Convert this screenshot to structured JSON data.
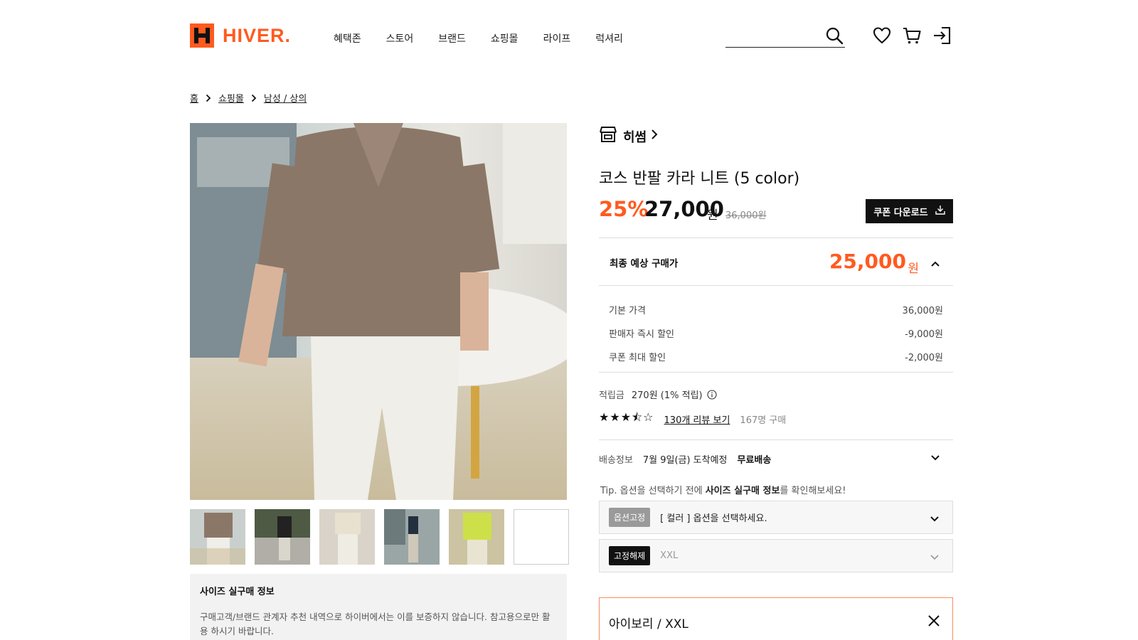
{
  "header": {
    "logo_letter": "H",
    "logo_text": "HIVER.",
    "nav": [
      "혜택존",
      "스토어",
      "브랜드",
      "쇼핑몰",
      "라이프",
      "럭셔리"
    ],
    "search_value": "",
    "icons": [
      "search-icon",
      "heart-icon",
      "cart-icon",
      "login-icon"
    ]
  },
  "breadcrumb": [
    "홈",
    "쇼핑몰",
    "남성 / 상의"
  ],
  "gallery": {
    "thumbnail_count": 6
  },
  "size_info": {
    "title": "사이즈 실구매 정보",
    "desc": "구매고객/브랜드 관계자 추천 내역으로 하이버에서는 이를 보증하지 않습니다. 참고용으로만 활용 하시기 바랍니다."
  },
  "product": {
    "brand": "히썸",
    "title": "코스 반팔 카라 니트 (5 color)",
    "discount": "25%",
    "sale_price": "27,000",
    "won": "원",
    "original_price": "36,000원",
    "coupon_label": "쿠폰 다운로드",
    "final_label": "최종 예상 구매가",
    "final_price": "25,000",
    "breakdown": [
      {
        "label": "기본 가격",
        "value": "36,000원"
      },
      {
        "label": "판매자 즉시 할인",
        "value": "-9,000원"
      },
      {
        "label": "쿠폰 최대 할인",
        "value": "-2,000원"
      }
    ],
    "points_label": "적립금",
    "points_value": "270원 (1% 적립)",
    "stars": "★★★⯪☆",
    "rating": 3.5,
    "review_link": "130개 리뷰 보기",
    "purchase_count": "167명 구매",
    "shipping_label": "배송정보",
    "shipping_date": "7월 9일(금) 도착예정",
    "shipping_fee": "무료배송",
    "tip_prefix": "Tip. 옵션을 선택하기 전에 ",
    "tip_bold": "사이즈 실구매 정보",
    "tip_suffix": "를 확인해보세요!",
    "option1_badge": "옵션고정",
    "option1_text": "[ 컬러 ] 옵션을 선택하세요.",
    "option2_badge": "고정해제",
    "option2_text": "XXL",
    "selected_option": "아이보리 /  XXL"
  },
  "colors": {
    "accent": "#ff5a1f",
    "dark": "#111111"
  }
}
